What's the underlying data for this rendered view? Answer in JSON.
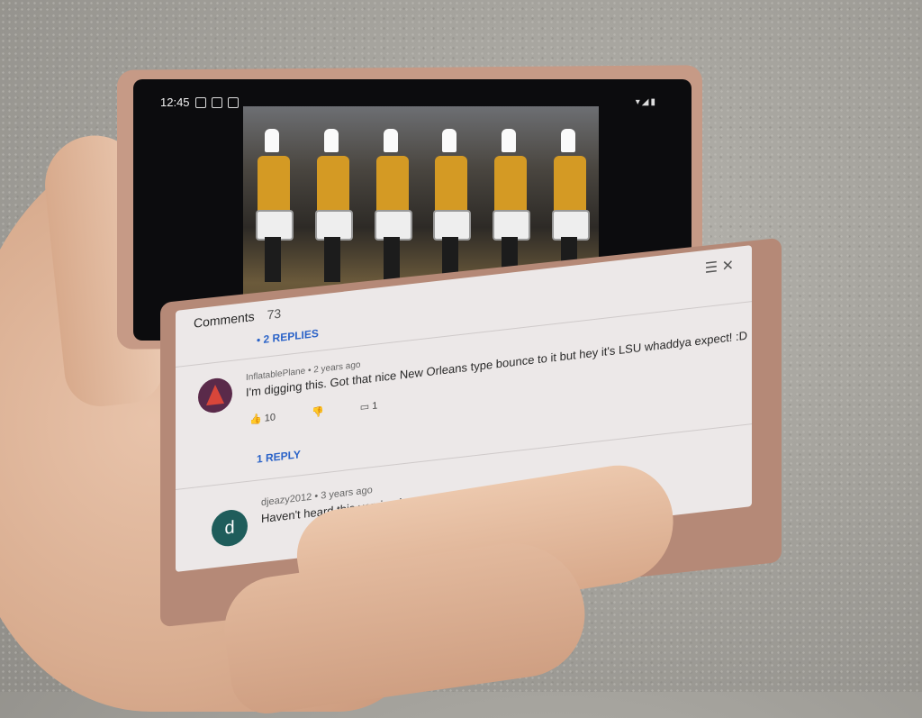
{
  "status_bar": {
    "time": "12:45"
  },
  "comments": {
    "title": "Comments",
    "count": "73",
    "thread1_replies": "• 2 REPLIES",
    "comment1": {
      "author_meta": "InflatablePlane • 2 years ago",
      "text": "I'm digging this. Got that nice New Orleans type bounce to it but hey it's LSU whaddya expect! :D",
      "likes": "10",
      "replies_count": "1",
      "reply_link": "1 REPLY"
    },
    "comment2": {
      "avatar_letter": "d",
      "author_meta": "djeazy2012 • 3 years ago",
      "text": "Haven't heard this version in a while awesome videos"
    }
  },
  "colors": {
    "link": "#2b63c8",
    "panel": "#ece8e8",
    "uniform": "#d49a24"
  },
  "icons": [
    "thumbs-up-icon",
    "thumbs-down-icon",
    "reply-icon",
    "filter-icon",
    "close-icon"
  ]
}
